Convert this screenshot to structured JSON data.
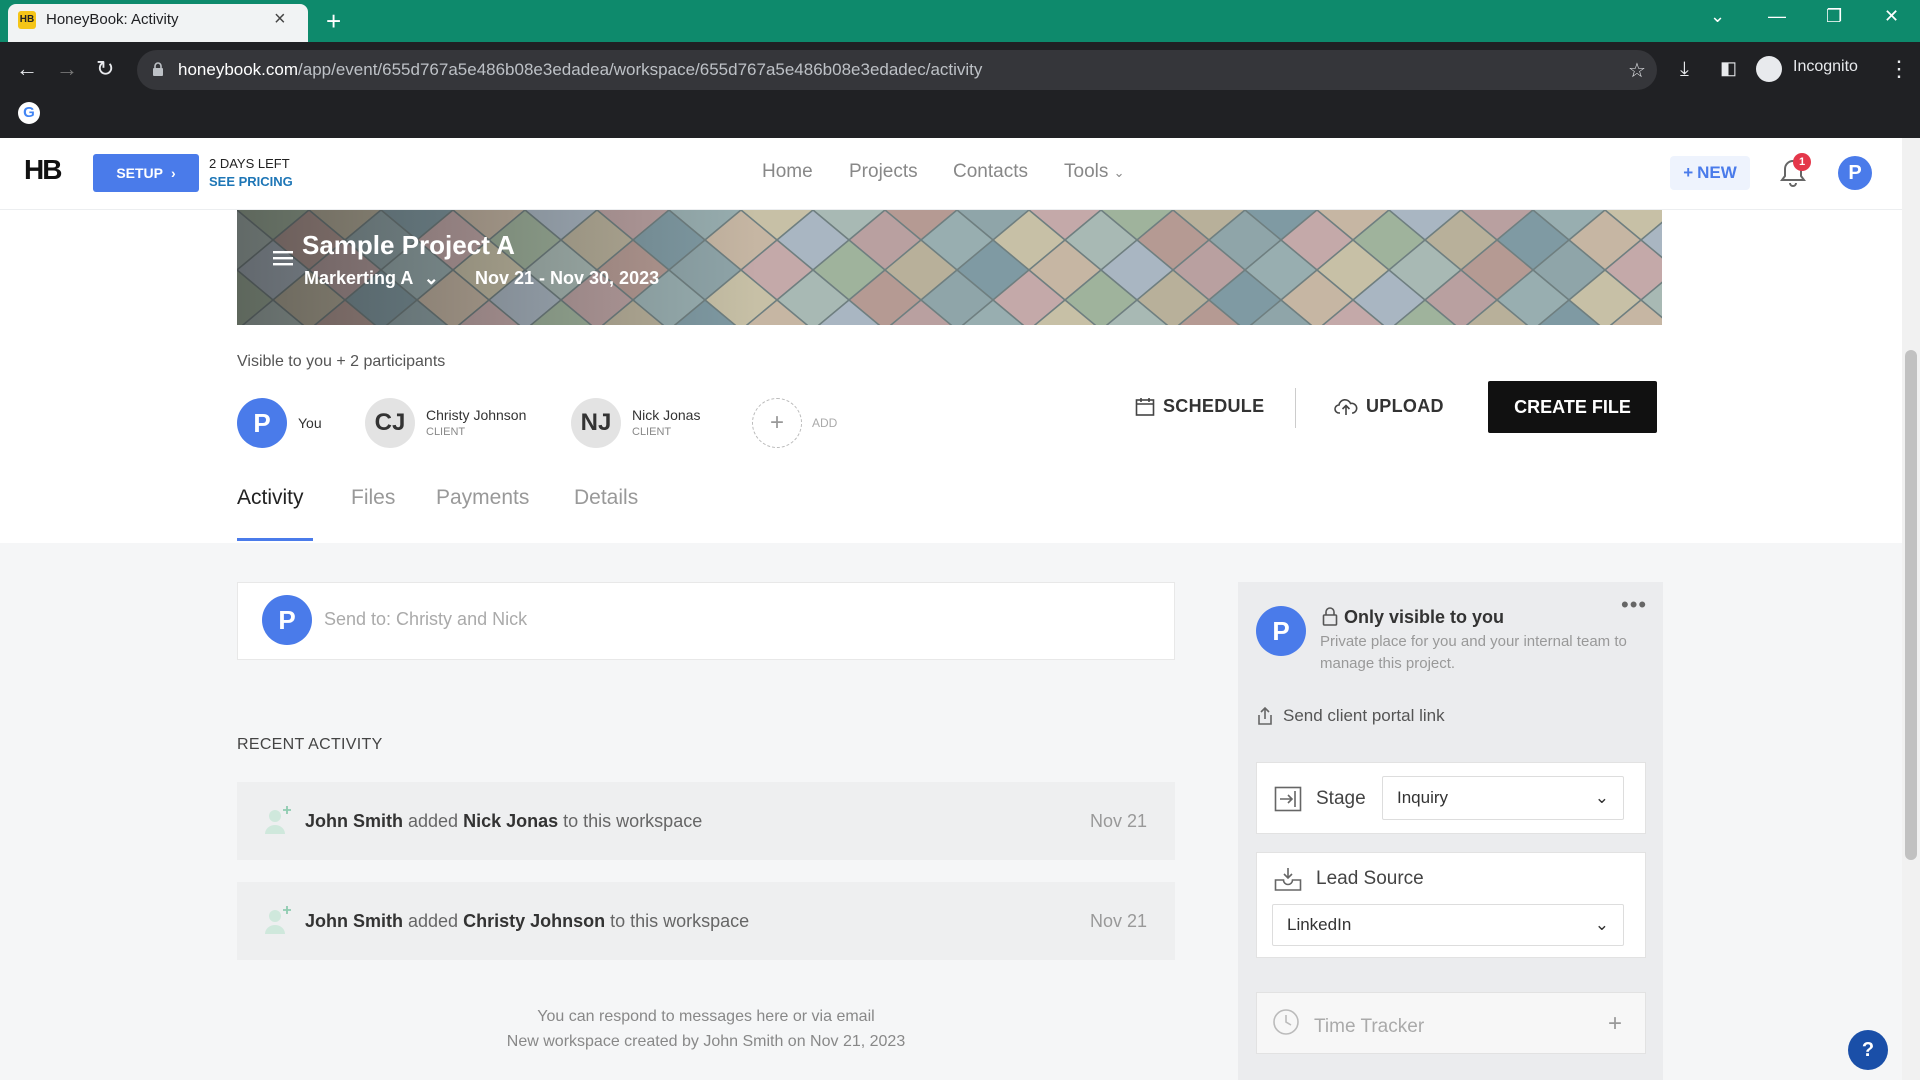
{
  "browser": {
    "tab_title": "HoneyBook: Activity",
    "tab_favicon": "HB",
    "url_host": "honeybook.com",
    "url_path": "/app/event/655d767a5e486b08e3edadea/workspace/655d767a5e486b08e3edadec/activity",
    "incognito_label": "Incognito",
    "bookmark_icon": "G"
  },
  "header": {
    "logo": "HB",
    "setup_label": "SETUP",
    "days_left": "2 DAYS LEFT",
    "see_pricing": "SEE PRICING",
    "nav": [
      "Home",
      "Projects",
      "Contacts",
      "Tools"
    ],
    "new_label": "NEW",
    "notification_count": "1",
    "user_initial": "P"
  },
  "project": {
    "title": "Sample Project A",
    "category": "Markerting A",
    "dates": "Nov 21 - Nov 30, 2023",
    "visibility": "Visible to you + 2 participants"
  },
  "participants": [
    {
      "initials": "P",
      "name": "You",
      "role": ""
    },
    {
      "initials": "CJ",
      "name": "Christy Johnson",
      "role": "CLIENT"
    },
    {
      "initials": "NJ",
      "name": "Nick Jonas",
      "role": "CLIENT"
    }
  ],
  "add_label": "ADD",
  "actions": {
    "schedule": "SCHEDULE",
    "upload": "UPLOAD",
    "create_file": "CREATE FILE"
  },
  "tabs": [
    "Activity",
    "Files",
    "Payments",
    "Details"
  ],
  "composer": {
    "avatar": "P",
    "placeholder": "Send to: Christy and Nick"
  },
  "recent": {
    "heading": "RECENT ACTIVITY",
    "items": [
      {
        "actor": "John Smith",
        "verb": "added",
        "target": "Nick Jonas",
        "suffix": "to this workspace",
        "date": "Nov 21"
      },
      {
        "actor": "John Smith",
        "verb": "added",
        "target": "Christy Johnson",
        "suffix": "to this workspace",
        "date": "Nov 21"
      }
    ],
    "footer_line1": "You can respond to messages here or via email",
    "footer_line2": "New workspace created by John Smith on Nov 21, 2023"
  },
  "sidebar": {
    "avatar": "P",
    "only_visible": "Only visible to you",
    "description": "Private place for you and your internal team to manage this project.",
    "portal_link": "Send client portal link",
    "stage_label": "Stage",
    "stage_value": "Inquiry",
    "lead_source_label": "Lead Source",
    "lead_source_value": "LinkedIn",
    "time_tracker_label": "Time Tracker"
  },
  "help_label": "?",
  "colors": {
    "accent": "#4a7bea",
    "chrome_tab_strip": "#0e8a6c",
    "create_file_bg": "#111111"
  }
}
